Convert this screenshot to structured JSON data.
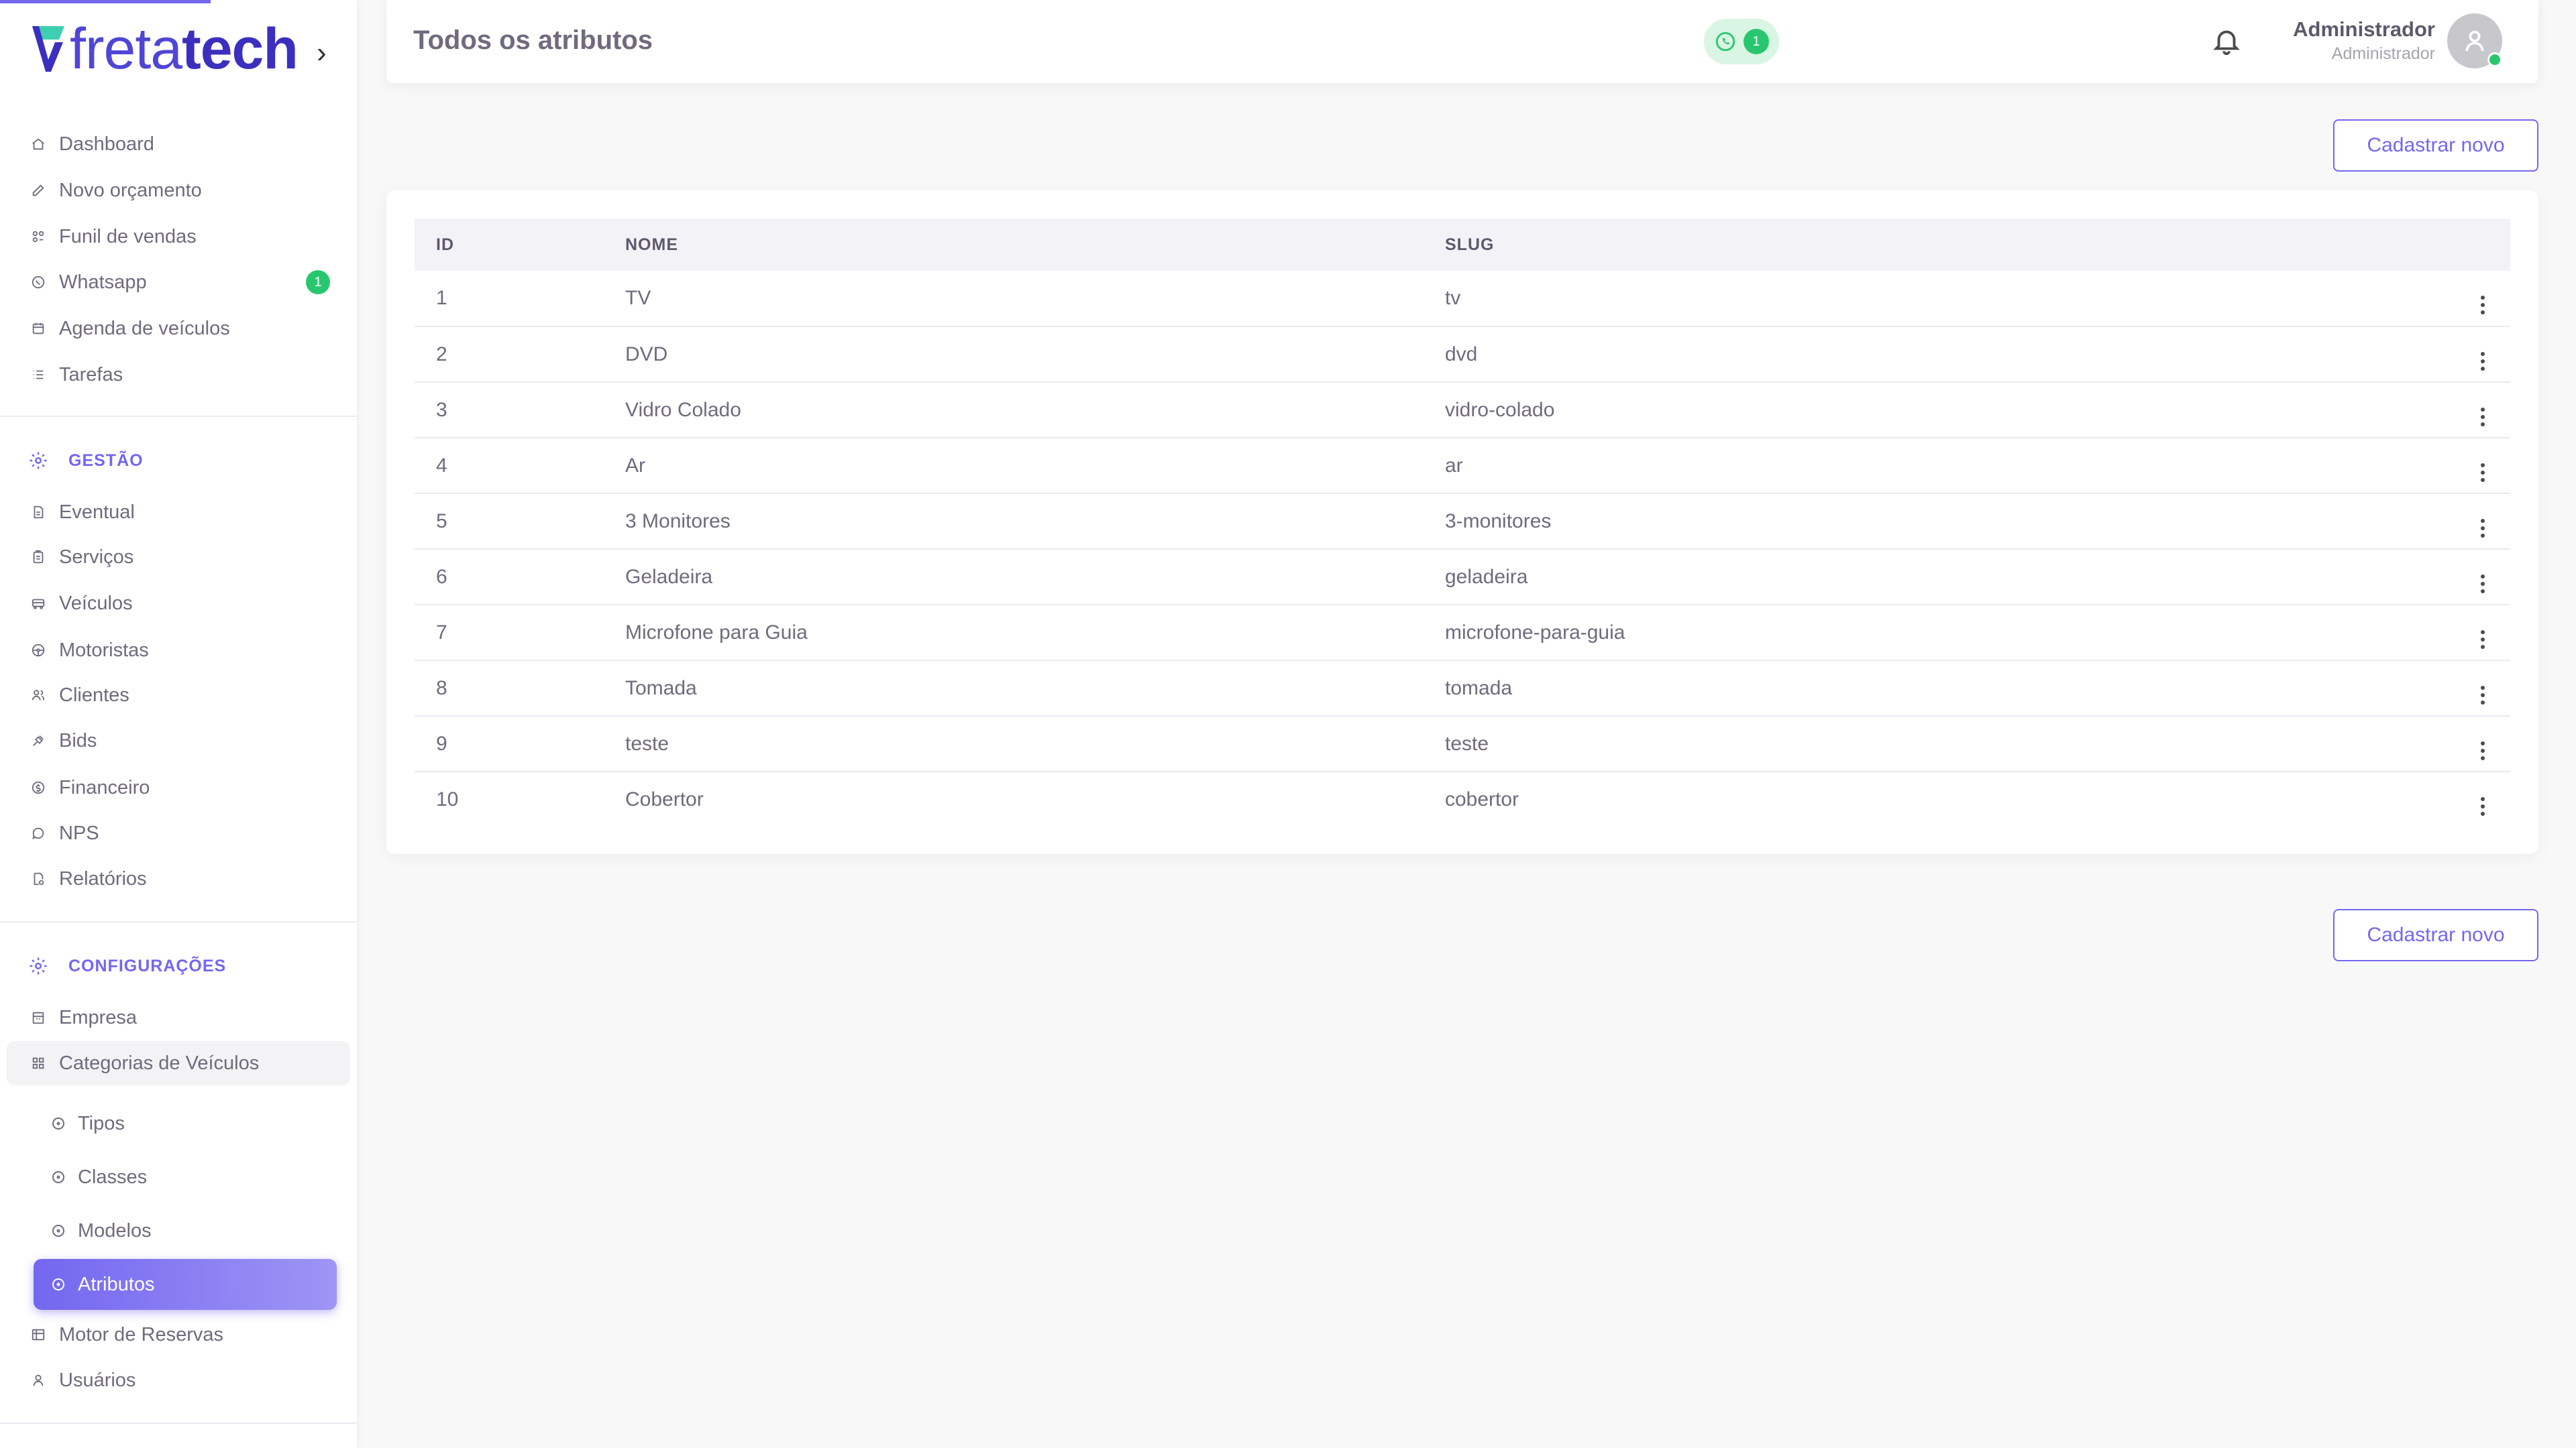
{
  "brand": {
    "part1": "freta",
    "part2": "tech"
  },
  "header": {
    "title": "Todos os atributos",
    "whatsapp_count": "1",
    "user_name": "Administrador",
    "user_role": "Administrador"
  },
  "sidebar": {
    "main_items": [
      {
        "label": "Dashboard",
        "icon": "home-icon"
      },
      {
        "label": "Novo orçamento",
        "icon": "edit-icon"
      },
      {
        "label": "Funil de vendas",
        "icon": "filter-icon"
      },
      {
        "label": "Whatsapp",
        "icon": "whatsapp-icon",
        "badge": "1"
      },
      {
        "label": "Agenda de veículos",
        "icon": "calendar-icon"
      },
      {
        "label": "Tarefas",
        "icon": "list-icon"
      }
    ],
    "gestao_header": "GESTÃO",
    "gestao_items": [
      {
        "label": "Eventual",
        "icon": "file-icon"
      },
      {
        "label": "Serviços",
        "icon": "clipboard-icon"
      },
      {
        "label": "Veículos",
        "icon": "bus-icon"
      },
      {
        "label": "Motoristas",
        "icon": "steering-wheel-icon"
      },
      {
        "label": "Clientes",
        "icon": "users-icon"
      },
      {
        "label": "Bids",
        "icon": "gavel-icon"
      },
      {
        "label": "Financeiro",
        "icon": "coin-icon"
      },
      {
        "label": "NPS",
        "icon": "message-icon"
      },
      {
        "label": "Relatórios",
        "icon": "report-icon"
      }
    ],
    "config_header": "CONFIGURAÇÕES",
    "config_items": [
      {
        "label": "Empresa",
        "icon": "building-icon"
      },
      {
        "label": "Categorias de Veículos",
        "icon": "grid-icon"
      }
    ],
    "sub_items": [
      {
        "label": "Tipos"
      },
      {
        "label": "Classes"
      },
      {
        "label": "Modelos"
      },
      {
        "label": "Atributos"
      }
    ],
    "bottom_items": [
      {
        "label": "Motor de Reservas",
        "icon": "table-icon"
      },
      {
        "label": "Usuários",
        "icon": "user-icon"
      }
    ]
  },
  "actions": {
    "new_label": "Cadastrar novo"
  },
  "table": {
    "columns": [
      "ID",
      "NOME",
      "SLUG"
    ],
    "rows": [
      {
        "id": "1",
        "nome": "TV",
        "slug": "tv"
      },
      {
        "id": "2",
        "nome": "DVD",
        "slug": "dvd"
      },
      {
        "id": "3",
        "nome": "Vidro Colado",
        "slug": "vidro-colado"
      },
      {
        "id": "4",
        "nome": "Ar",
        "slug": "ar"
      },
      {
        "id": "5",
        "nome": "3 Monitores",
        "slug": "3-monitores"
      },
      {
        "id": "6",
        "nome": "Geladeira",
        "slug": "geladeira"
      },
      {
        "id": "7",
        "nome": "Microfone para Guia",
        "slug": "microfone-para-guia"
      },
      {
        "id": "8",
        "nome": "Tomada",
        "slug": "tomada"
      },
      {
        "id": "9",
        "nome": "teste",
        "slug": "teste"
      },
      {
        "id": "10",
        "nome": "Cobertor",
        "slug": "cobertor"
      }
    ]
  },
  "colors": {
    "accent": "#7367f0",
    "success": "#28c76f"
  }
}
